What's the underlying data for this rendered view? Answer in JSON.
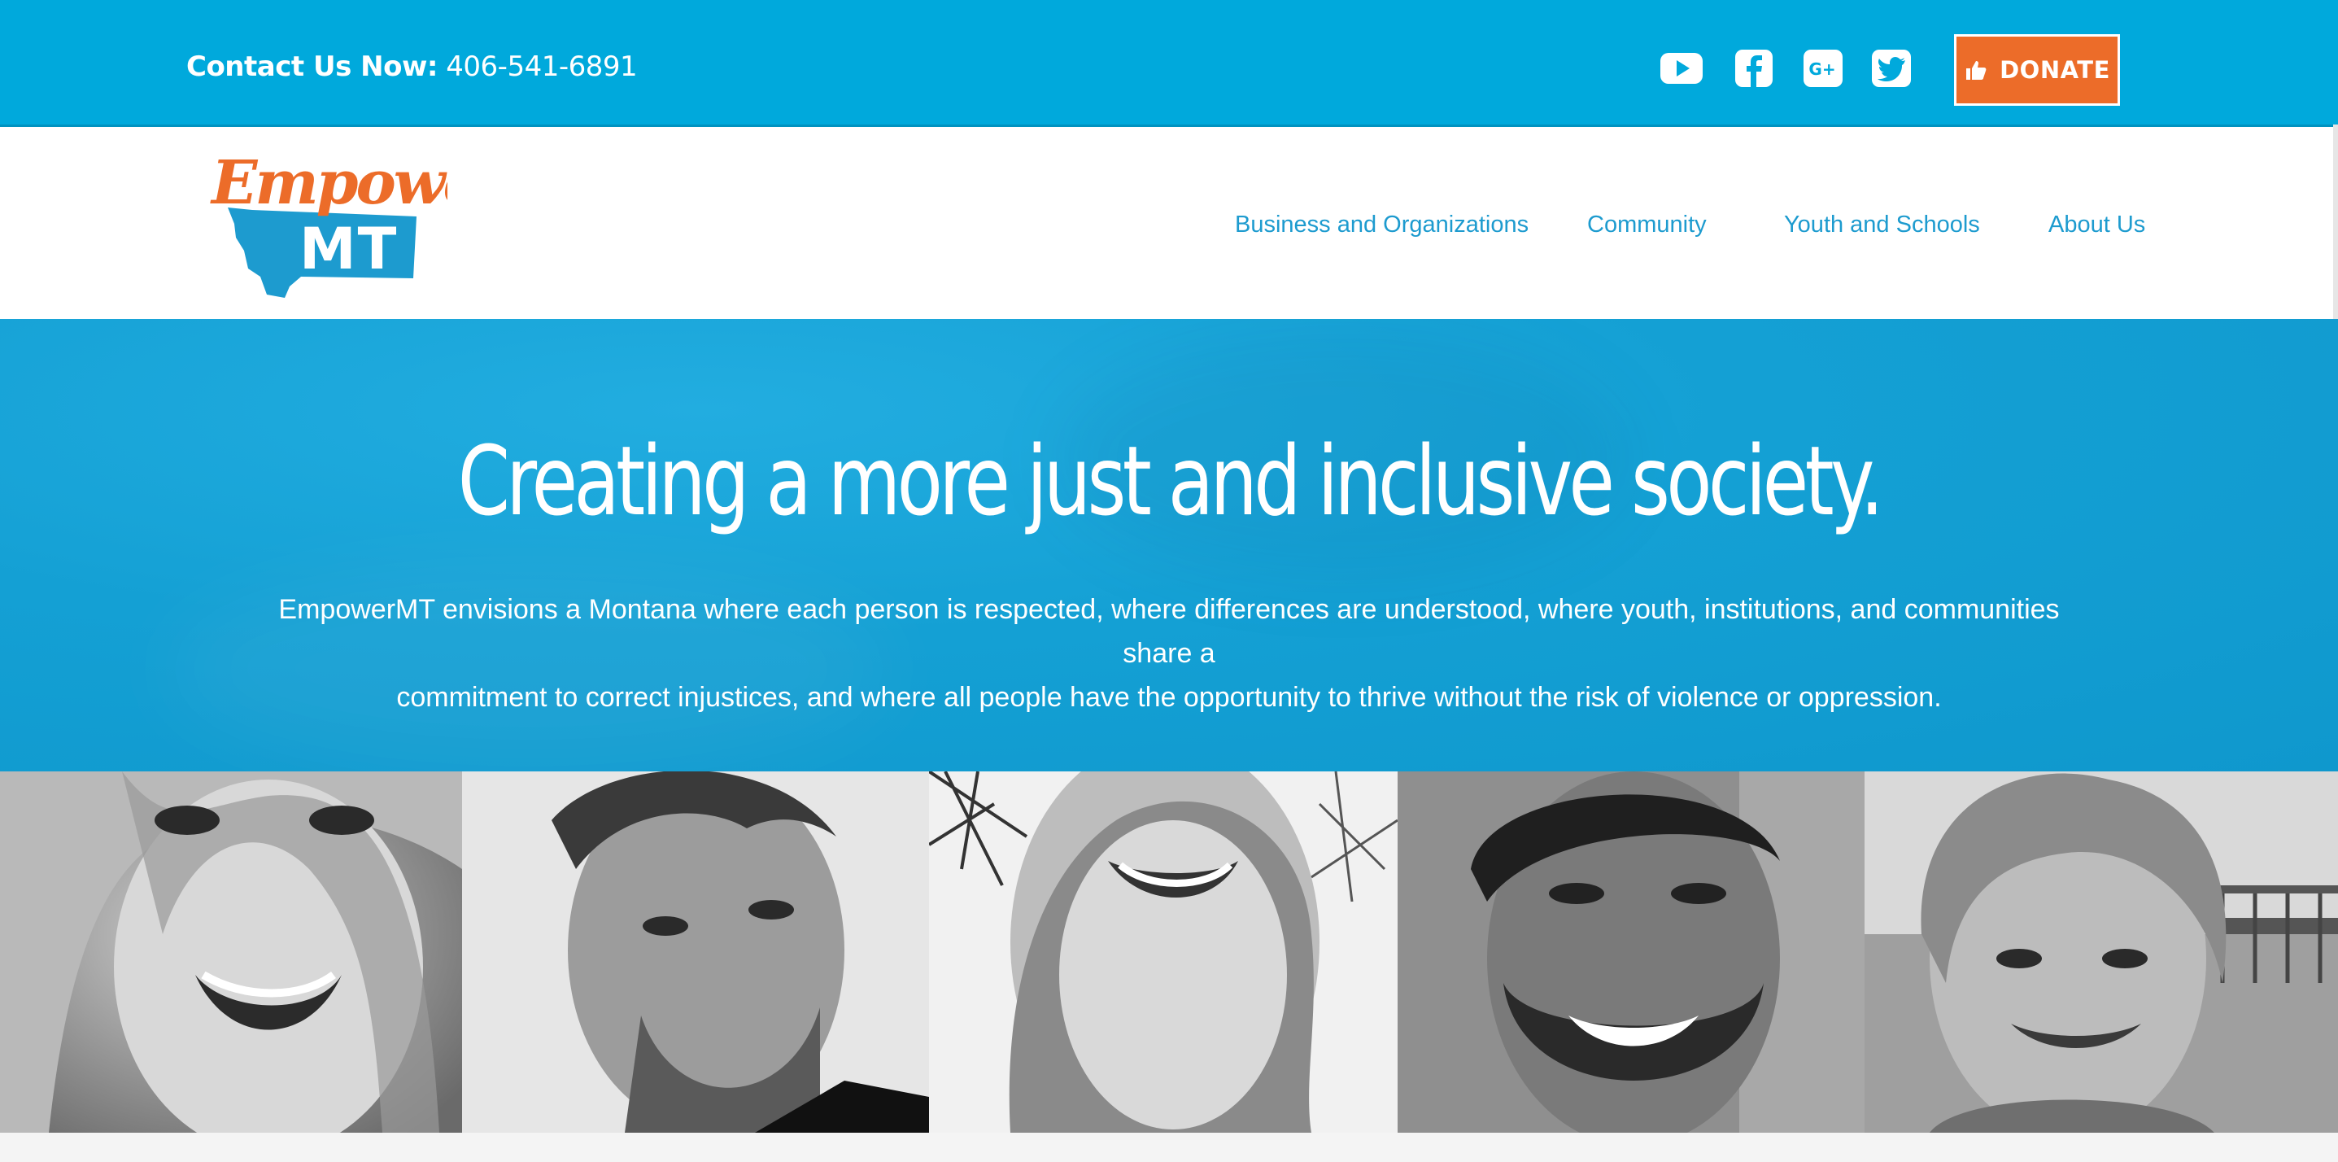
{
  "topbar": {
    "contact_label": "Contact Us Now:",
    "phone": "406-541-6891",
    "social": [
      {
        "name": "youtube-icon"
      },
      {
        "name": "facebook-icon"
      },
      {
        "name": "google-plus-icon"
      },
      {
        "name": "twitter-icon"
      }
    ],
    "donate_label": "DONATE"
  },
  "logo": {
    "line1": "Empower",
    "line2": "MT"
  },
  "nav": {
    "items": [
      {
        "label": "Business and Organizations"
      },
      {
        "label": "Community"
      },
      {
        "label": "Youth and Schools"
      },
      {
        "label": "About Us"
      }
    ]
  },
  "hero": {
    "headline": "Creating a more just and inclusive society.",
    "body_line1": "EmpowerMT envisions a Montana where each person is respected, where differences are understood, where youth, institutions, and communities share a",
    "body_line2": "commitment to correct injustices, and where all people have the opportunity to thrive without the risk of violence or oppression."
  },
  "colors": {
    "brand_blue": "#00a9dc",
    "hero_blue": "#14a0d4",
    "accent_orange": "#ec6c29",
    "nav_blue": "#1d9bcf"
  }
}
